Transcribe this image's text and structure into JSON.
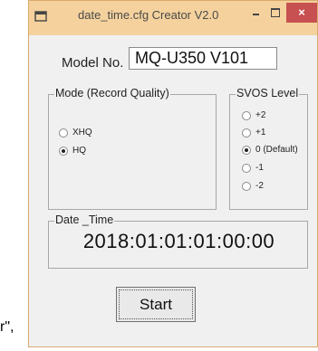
{
  "window": {
    "title": "date_time.cfg Creator V2.0",
    "controls": {
      "minimize": "minimize",
      "maximize": "maximize",
      "close": "×"
    }
  },
  "model": {
    "label": "Model No.",
    "value": "MQ-U350 V101"
  },
  "mode_group": {
    "legend": "Mode (Record Quality)",
    "options": [
      {
        "label": "XHQ",
        "checked": false
      },
      {
        "label": "HQ",
        "checked": true
      }
    ]
  },
  "svos_group": {
    "legend": "SVOS Level",
    "options": [
      {
        "label": "+2",
        "checked": false
      },
      {
        "label": "+1",
        "checked": false
      },
      {
        "label": "0 (Default)",
        "checked": true
      },
      {
        "label": "-1",
        "checked": false
      },
      {
        "label": "-2",
        "checked": false
      }
    ]
  },
  "datetime_group": {
    "legend": "Date _Time",
    "value": "2018:01:01:01:00:00"
  },
  "start_button": {
    "label": "Start"
  },
  "background_text": "r\","
}
